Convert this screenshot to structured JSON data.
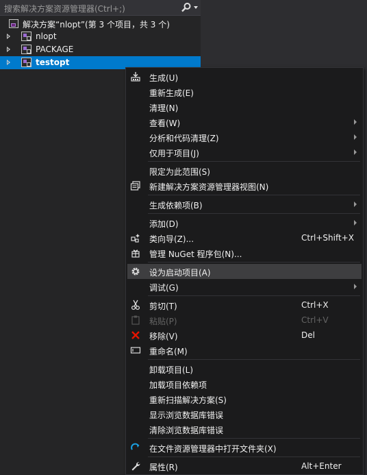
{
  "search": {
    "placeholder": "搜索解决方案资源管理器(Ctrl+;)"
  },
  "tree": {
    "solution_label": "解决方案“nlopt”(第 3 个项目，共 3 个)",
    "projects": [
      "nlopt",
      "PACKAGE",
      "testopt"
    ],
    "selected": "testopt"
  },
  "menu": {
    "build": "生成(U)",
    "rebuild": "重新生成(E)",
    "clean": "清理(N)",
    "view": "查看(W)",
    "analyze": "分析和代码清理(Z)",
    "project_only": "仅用于项目(J)",
    "scope": "限定为此范围(S)",
    "new_view": "新建解决方案资源管理器视图(N)",
    "build_deps": "生成依赖项(B)",
    "add": "添加(D)",
    "class_wizard": "类向导(Z)...",
    "class_wizard_sc": "Ctrl+Shift+X",
    "nuget": "管理 NuGet 程序包(N)...",
    "set_startup": "设为启动项目(A)",
    "debug": "调试(G)",
    "cut": "剪切(T)",
    "cut_sc": "Ctrl+X",
    "paste": "粘贴(P)",
    "paste_sc": "Ctrl+V",
    "remove": "移除(V)",
    "remove_sc": "Del",
    "rename": "重命名(M)",
    "unload": "卸载项目(L)",
    "load_deps": "加载项目依赖项",
    "rescan": "重新扫描解决方案(S)",
    "show_db_errors": "显示浏览数据库错误",
    "clear_db_errors": "清除浏览数据库错误",
    "open_folder": "在文件资源管理器中打开文件夹(X)",
    "properties": "属性(R)",
    "properties_sc": "Alt+Enter"
  },
  "colors": {
    "selection": "#007acc",
    "menu_bg": "#1b1b1c",
    "hover": "#3e3e40",
    "remove_icon": "#e51400",
    "open_folder_icon": "#1ba1e2"
  }
}
